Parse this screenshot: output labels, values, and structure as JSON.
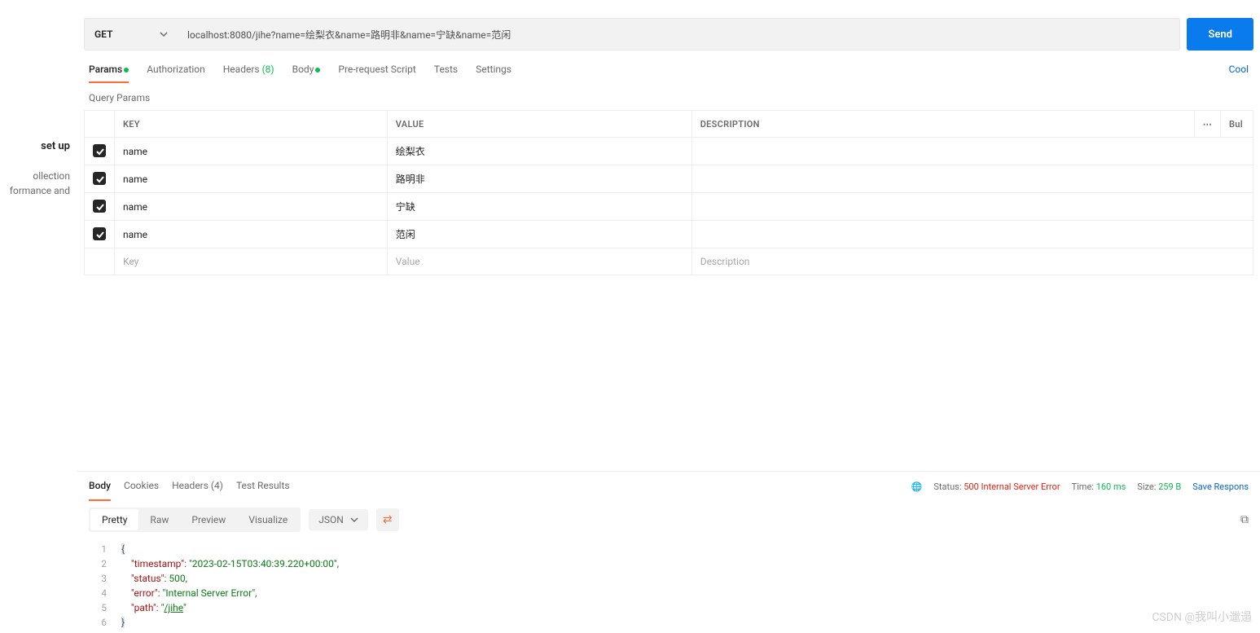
{
  "sidebar": {
    "title": "set up",
    "desc1": "ollection",
    "desc2": "formance and"
  },
  "request": {
    "method": "GET",
    "url": "localhost:8080/jihe?name=绘梨衣&name=路明非&name=宁缺&name=范闲",
    "send_label": "Send"
  },
  "req_tabs": {
    "params": "Params",
    "authorization": "Authorization",
    "headers": "Headers",
    "headers_count": "(8)",
    "body": "Body",
    "prerequest": "Pre-request Script",
    "tests": "Tests",
    "settings": "Settings",
    "cookies_link": "Cool"
  },
  "section_label": "Query Params",
  "table": {
    "headers": {
      "key": "KEY",
      "value": "VALUE",
      "description": "DESCRIPTION",
      "bulk": "Bul"
    },
    "rows": [
      {
        "key": "name",
        "value": "绘梨衣",
        "description": ""
      },
      {
        "key": "name",
        "value": "路明非",
        "description": ""
      },
      {
        "key": "name",
        "value": "宁缺",
        "description": ""
      },
      {
        "key": "name",
        "value": "范闲",
        "description": ""
      }
    ],
    "placeholder": {
      "key": "Key",
      "value": "Value",
      "description": "Description"
    }
  },
  "resp_tabs": {
    "body": "Body",
    "cookies": "Cookies",
    "headers": "Headers",
    "headers_count": "(4)",
    "tests": "Test Results"
  },
  "resp_meta": {
    "status_label": "Status:",
    "status_value": "500 Internal Server Error",
    "time_label": "Time:",
    "time_value": "160 ms",
    "size_label": "Size:",
    "size_value": "259 B",
    "save": "Save Respons"
  },
  "view_tabs": {
    "pretty": "Pretty",
    "raw": "Raw",
    "preview": "Preview",
    "visualize": "Visualize",
    "format": "JSON"
  },
  "code": {
    "l1": "{",
    "l2_key": "\"timestamp\"",
    "l2_val": "\"2023-02-15T03:40:39.220+00:00\"",
    "l3_key": "\"status\"",
    "l3_val": "500",
    "l4_key": "\"error\"",
    "l4_val": "\"Internal Server Error\"",
    "l5_key": "\"path\"",
    "l5_val_pre": "\"",
    "l5_link": "/jihe",
    "l5_val_post": "\"",
    "l6": "}"
  },
  "watermark": "CSDN @我叫小邋遢"
}
